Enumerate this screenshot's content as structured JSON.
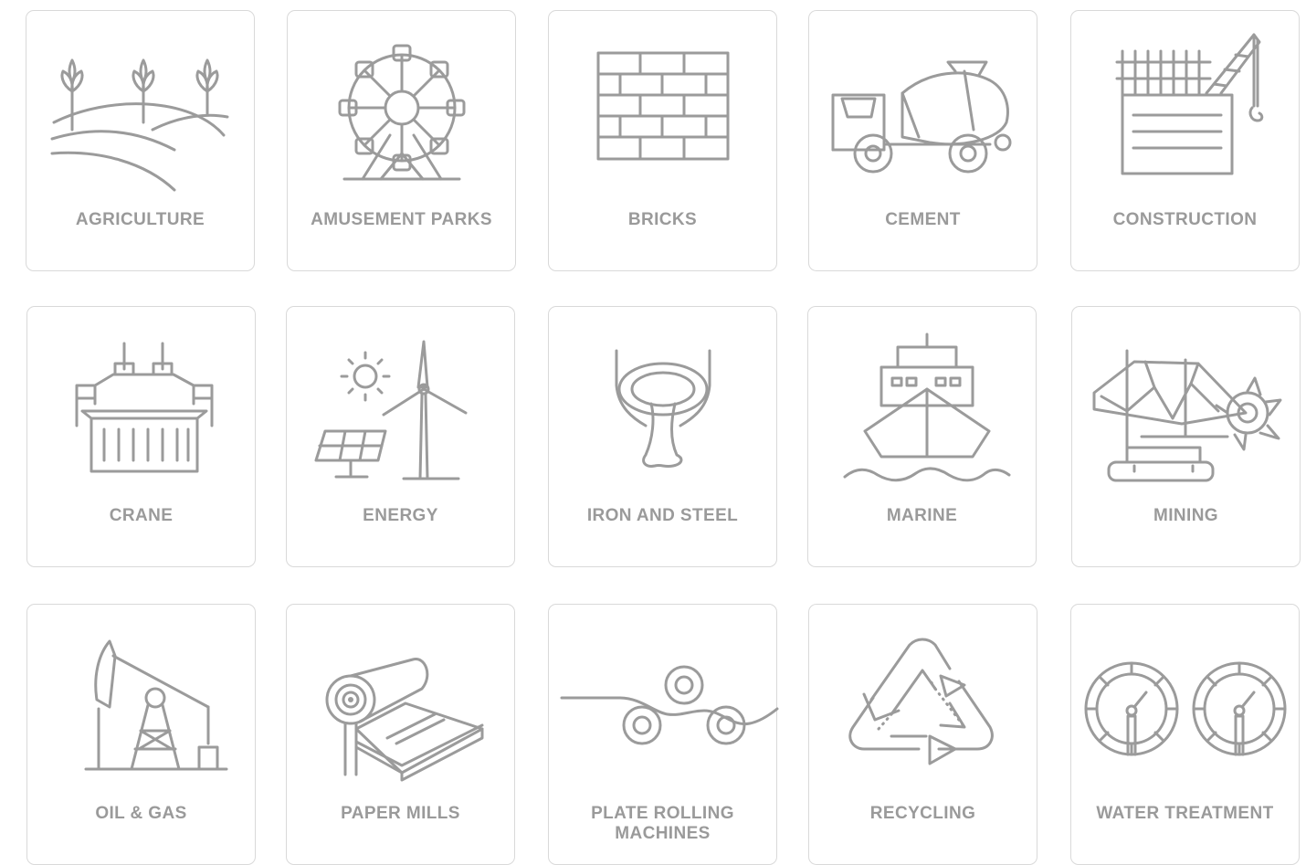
{
  "colors": {
    "icon": "#9b9b9b",
    "label": "#9a9a9a",
    "card_border": "#d9d9d9",
    "background": "#ffffff"
  },
  "industries": [
    {
      "label": "AGRICULTURE",
      "icon": "agriculture-icon"
    },
    {
      "label": "AMUSEMENT PARKS",
      "icon": "ferris-wheel-icon"
    },
    {
      "label": "BRICKS",
      "icon": "brick-wall-icon"
    },
    {
      "label": "CEMENT",
      "icon": "cement-mixer-truck-icon"
    },
    {
      "label": "CONSTRUCTION",
      "icon": "construction-crane-icon"
    },
    {
      "label": "CRANE",
      "icon": "container-crane-icon"
    },
    {
      "label": "ENERGY",
      "icon": "renewable-energy-icon"
    },
    {
      "label": "IRON AND STEEL",
      "icon": "ladle-icon"
    },
    {
      "label": "MARINE",
      "icon": "ship-icon"
    },
    {
      "label": "MINING",
      "icon": "bucket-wheel-excavator-icon"
    },
    {
      "label": "OIL & GAS",
      "icon": "oil-pumpjack-icon"
    },
    {
      "label": "PAPER MILLS",
      "icon": "paper-roll-icon"
    },
    {
      "label": "PLATE ROLLING MACHINES",
      "icon": "rolling-rollers-icon"
    },
    {
      "label": "RECYCLING",
      "icon": "recycling-icon"
    },
    {
      "label": "WATER TREATMENT",
      "icon": "water-treatment-gauge-icon"
    }
  ]
}
